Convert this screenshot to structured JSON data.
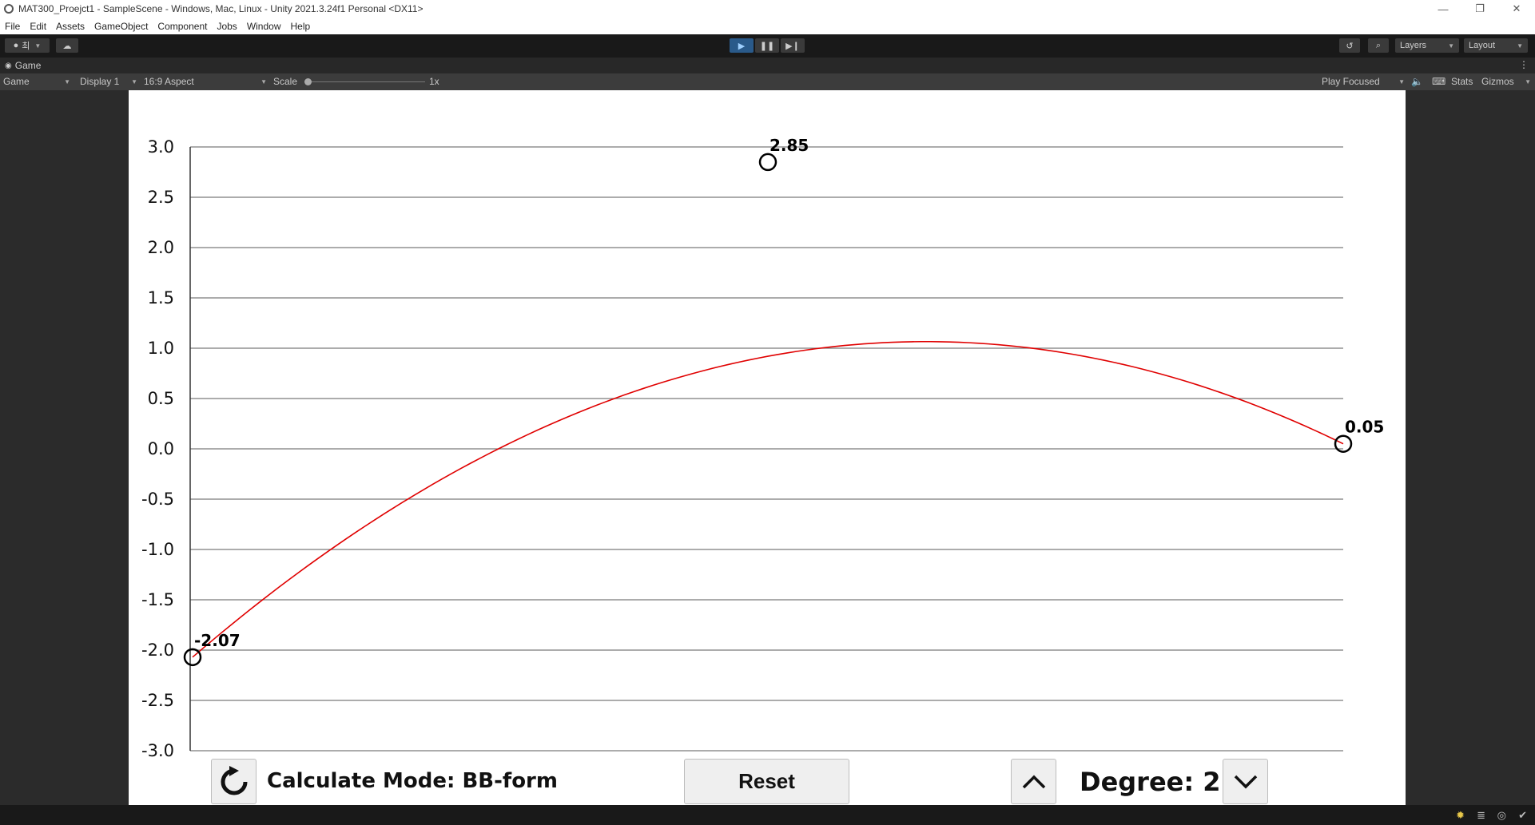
{
  "window": {
    "title": "MAT300_Proejct1 - SampleScene - Windows, Mac, Linux - Unity 2021.3.24f1 Personal <DX11>",
    "controls": [
      "—",
      "❐",
      "✕"
    ]
  },
  "menu": [
    "File",
    "Edit",
    "Assets",
    "GameObject",
    "Component",
    "Jobs",
    "Window",
    "Help"
  ],
  "toolbar": {
    "account_label": "최",
    "layers_label": "Layers",
    "layout_label": "Layout"
  },
  "game_tab": {
    "tab_label": "Game",
    "mode": "Game",
    "display": "Display 1",
    "aspect": "16:9 Aspect",
    "scale_label": "Scale",
    "scale_value": "1x",
    "play_focused": "Play Focused",
    "stats": "Stats",
    "gizmos": "Gizmos"
  },
  "game_ui": {
    "calc_mode_text": "Calculate Mode: BB-form",
    "reset_label": "Reset",
    "degree_text": "Degree: 2"
  },
  "colors": {
    "curve": "#e00000",
    "accent_play": "#2a5a8a",
    "editor_bg": "#191919"
  },
  "chart_data": {
    "type": "line",
    "ylim": [
      -3.0,
      3.0
    ],
    "ytick_labels": [
      "3.0",
      "2.5",
      "2.0",
      "1.5",
      "1.0",
      "0.5",
      "0.0",
      "-0.5",
      "-1.0",
      "-1.5",
      "-2.0",
      "-2.5",
      "-3.0"
    ],
    "ytick_values": [
      3.0,
      2.5,
      2.0,
      1.5,
      1.0,
      0.5,
      0.0,
      -0.5,
      -1.0,
      -1.5,
      -2.0,
      -2.5,
      -3.0
    ],
    "xlim": [
      0,
      1
    ],
    "grid": true,
    "control_points": [
      {
        "t": 0.0,
        "value": -2.07,
        "label": "-2.07"
      },
      {
        "t": 0.5,
        "value": 2.85,
        "label": "2.85"
      },
      {
        "t": 1.0,
        "value": 0.05,
        "label": "0.05"
      }
    ],
    "curve": "bernstein-bezier degree 2"
  }
}
